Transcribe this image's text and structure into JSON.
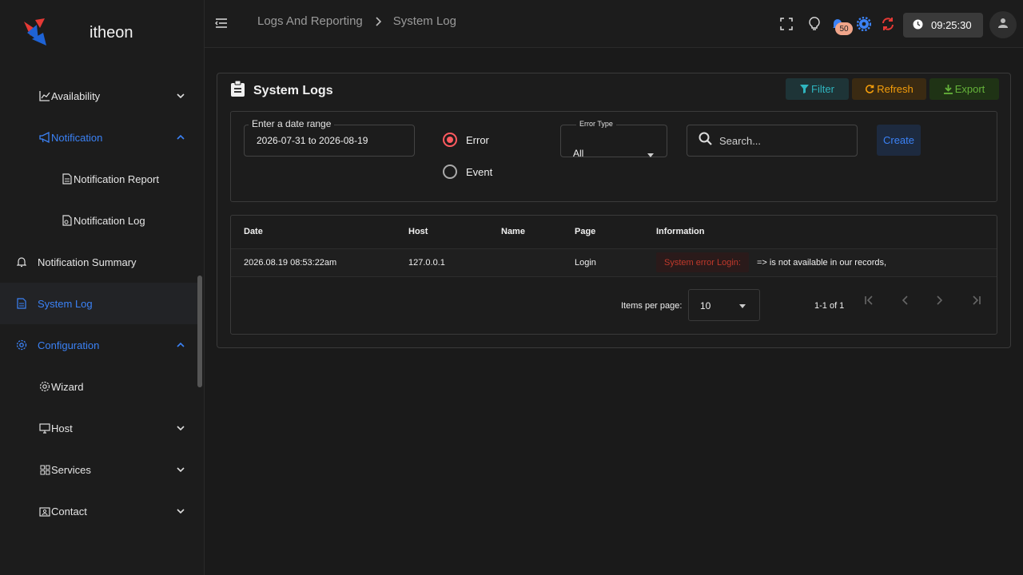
{
  "brand": {
    "name": "itheon"
  },
  "sidebar": {
    "items": [
      {
        "label": "Availability"
      },
      {
        "label": "Notification"
      },
      {
        "label": "Notification Report"
      },
      {
        "label": "Notification Log"
      },
      {
        "label": "Notification Summary"
      },
      {
        "label": "System Log"
      },
      {
        "label": "Configuration"
      },
      {
        "label": "Wizard"
      },
      {
        "label": "Host"
      },
      {
        "label": "Services"
      },
      {
        "label": "Contact"
      }
    ]
  },
  "header": {
    "breadcrumb": [
      "Logs And Reporting",
      "System Log"
    ],
    "notification_count": "50",
    "clock": "09:25:30"
  },
  "card": {
    "title": "System Logs",
    "filter_label": "Filter",
    "refresh_label": "Refresh",
    "export_label": "Export"
  },
  "filters": {
    "date_label": "Enter a date range",
    "date_value": "2026-07-31 to 2026-08-19",
    "radio_error": "Error",
    "radio_event": "Event",
    "selected_radio": "Error",
    "error_type_label": "Error Type",
    "error_type_value": "All",
    "search_placeholder": "Search...",
    "create_label": "Create"
  },
  "table": {
    "columns": [
      "Date",
      "Host",
      "Name",
      "Page",
      "Information"
    ],
    "rows": [
      {
        "date": "2026.08.19 08:53:22am",
        "host": "127.0.0.1",
        "name": "",
        "page": "Login",
        "info_tag": "System error Login:",
        "info_text": "=> is not available in our records,"
      }
    ]
  },
  "pagination": {
    "items_per_page_label": "Items per page:",
    "items_per_page": "10",
    "range": "1-1 of 1"
  },
  "colors": {
    "accent": "#3b82f6",
    "error": "#ff5a5f",
    "refresh": "#f59e0b",
    "export": "#65b33a",
    "filter": "#2fb5bf"
  }
}
